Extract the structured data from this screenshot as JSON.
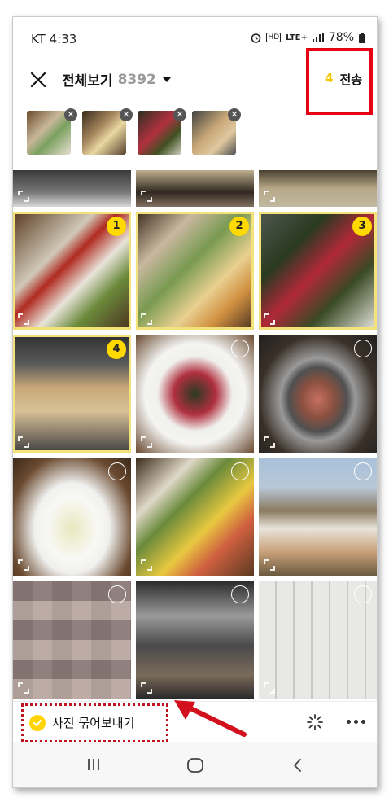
{
  "status_bar": {
    "carrier_time": "KT 4:33",
    "hd": "HD",
    "network": "LTE+",
    "battery": "78%"
  },
  "header": {
    "title": "전체보기",
    "count": "8392",
    "send_count": "4",
    "send_label": "전송"
  },
  "selected_thumbs": [
    {
      "alt": "selected photo 1"
    },
    {
      "alt": "selected photo 2"
    },
    {
      "alt": "selected photo 3"
    },
    {
      "alt": "selected photo 4"
    }
  ],
  "grid_badges": {
    "b1": "1",
    "b2": "2",
    "b3": "3",
    "b4": "4"
  },
  "bottom_bar": {
    "bundle_label": "사진 묶어보내기"
  },
  "colors": {
    "accent_yellow": "#ffd900",
    "annotation_red": "#e60012"
  }
}
